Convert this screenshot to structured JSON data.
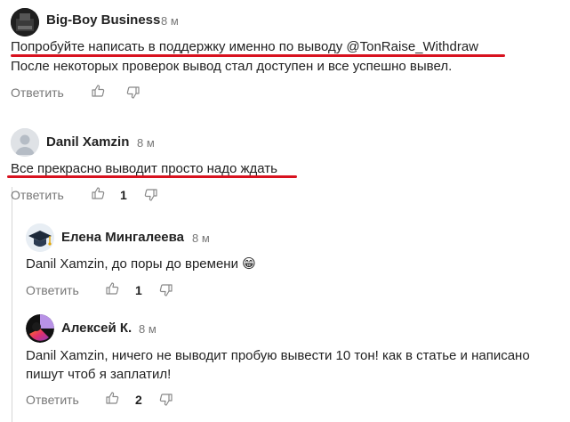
{
  "comments": [
    {
      "author": "Big-Boy Business",
      "time": "8 м",
      "lines": [
        "Попробуйте написать в поддержку именно по выводу @TonRaise_Withdraw",
        "После некоторых проверок вывод стал доступен и все успешно вывел."
      ],
      "reply_label": "Ответить",
      "likes": ""
    },
    {
      "author": "Danil Xamzin",
      "time": "8 м",
      "lines": [
        "Все прекрасно выводит просто надо ждать"
      ],
      "reply_label": "Ответить",
      "likes": "1"
    },
    {
      "author": "Елена Мингалеева",
      "time": "8 м",
      "lines": [
        "Danil Xamzin, до поры до времени"
      ],
      "emoji": "😁",
      "reply_label": "Ответить",
      "likes": "1"
    },
    {
      "author": "Алексей К.",
      "time": "8 м",
      "lines": [
        "Danil Xamzin, ничего не выводит пробую вывести 10 тон! как в статье и написано",
        "пишут чтоб я заплатил!"
      ],
      "reply_label": "Ответить",
      "likes": "2"
    }
  ],
  "colors": {
    "underline": "#d8121f",
    "muted": "#777777",
    "text": "#222222"
  },
  "icons": [
    "thumbs-up-icon",
    "thumbs-down-icon"
  ]
}
